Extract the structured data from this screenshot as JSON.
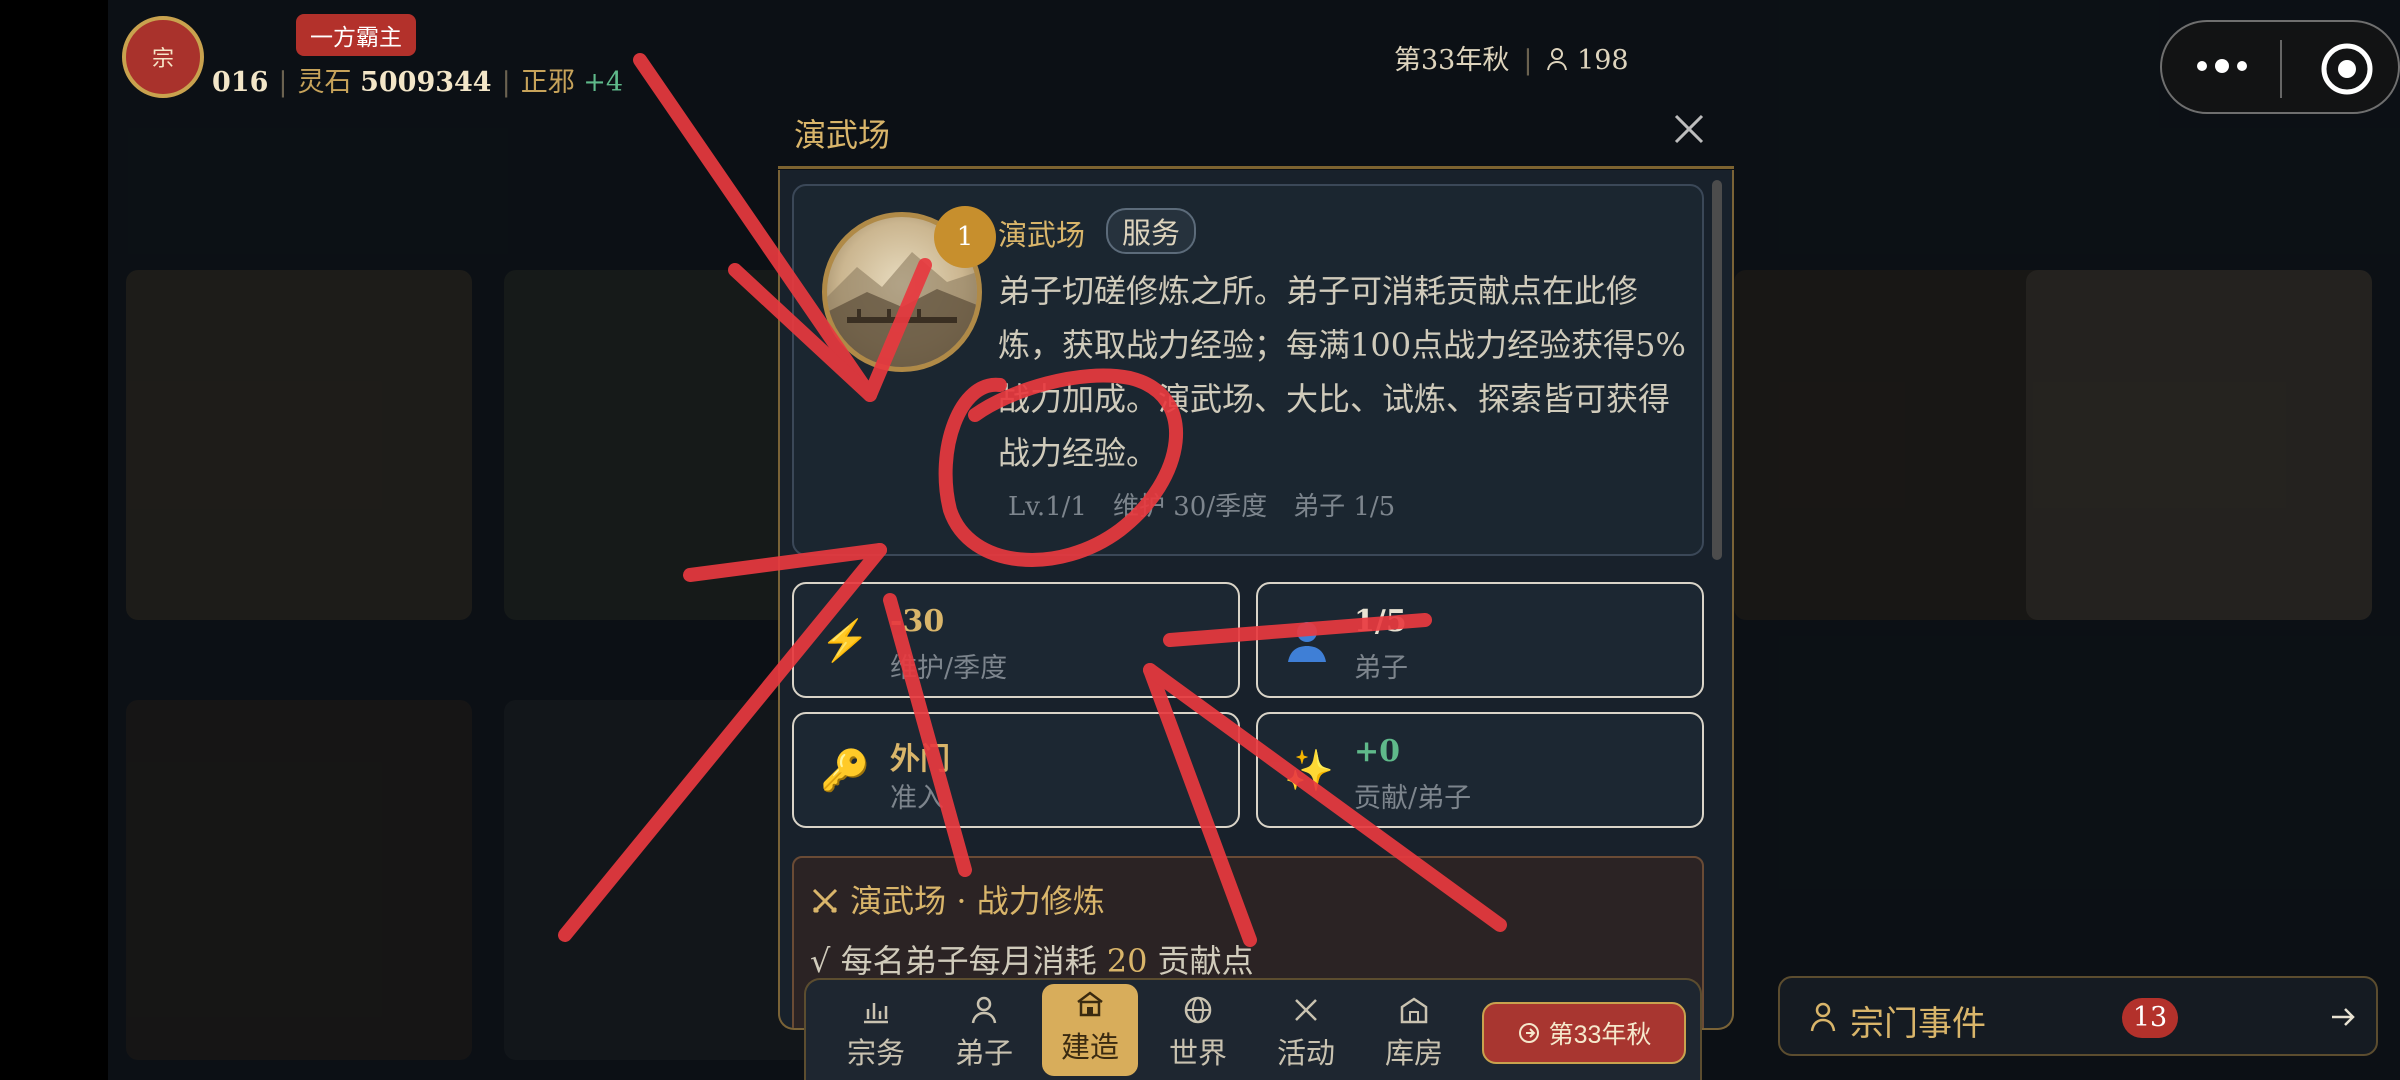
{
  "header": {
    "avatar_text": "宗",
    "title_badge": "一方霸主",
    "resource_partial": "016",
    "lingshi_label": "灵石",
    "lingshi_value": "5009344",
    "alignment_label": "正邪",
    "alignment_value": "+4",
    "season": "第33年秋",
    "population": "198"
  },
  "modal": {
    "title": "演武场",
    "building": {
      "level_badge": "1",
      "name": "演武场",
      "tag": "服务",
      "description": "弟子切磋修炼之所。弟子可消耗贡献点在此修炼，获取战力经验；每满100点战力经验获得5%战力加成。演武场、大比、试炼、探索皆可获得战力经验。",
      "meta": "Lv.1/1　维护 30/季度　弟子 1/5"
    },
    "stats": [
      {
        "value": "-30",
        "label": "维护/季度",
        "color": "#d9b56a"
      },
      {
        "value": "1/5",
        "label": "弟子",
        "color": "#e8e2d2"
      },
      {
        "value": "外门",
        "label": "准入",
        "color": "#d9b56a"
      },
      {
        "value": "+0",
        "label": "贡献/弟子",
        "color": "#5fb98a"
      }
    ],
    "training": {
      "title": "演武场 · 战力修炼",
      "line_prefix": "√ 每名弟子每月消耗",
      "line_amount": "20",
      "line_suffix": "贡献点"
    }
  },
  "nav": {
    "items": [
      {
        "label": "宗务"
      },
      {
        "label": "弟子"
      },
      {
        "label": "建造"
      },
      {
        "label": "世界"
      },
      {
        "label": "活动"
      },
      {
        "label": "库房"
      }
    ],
    "next_season": "第33年秋"
  },
  "events": {
    "label": "宗门事件",
    "count": "13"
  },
  "colors": {
    "gold": "#d9b56a",
    "red": "#b3312b",
    "green": "#5fb98a",
    "annotation": "#e8393f"
  }
}
